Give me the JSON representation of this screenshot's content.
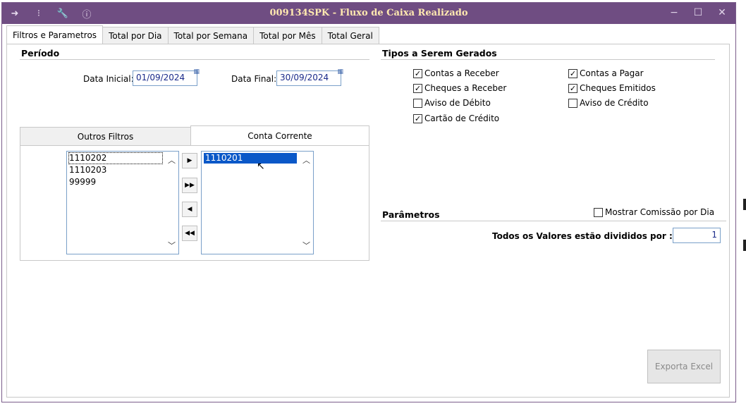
{
  "window": {
    "title": "009134SPK - Fluxo de Caixa Realizado",
    "toolbar_icons": [
      "menu-expand-icon",
      "tools-icon",
      "wrench-icon",
      "info-icon"
    ],
    "buttons": {
      "minimize": "−",
      "maximize": "☐",
      "close": "✕"
    }
  },
  "tabs": [
    {
      "label": "Filtros e Parametros",
      "active": true
    },
    {
      "label": "Total por Dia"
    },
    {
      "label": "Total por Semana"
    },
    {
      "label": "Total por Mês"
    },
    {
      "label": "Total Geral"
    }
  ],
  "periodo": {
    "title": "Período",
    "data_inicial_label": "Data Inicial:",
    "data_inicial": "01/09/2024",
    "data_final_label": "Data Final:",
    "data_final": "30/09/2024"
  },
  "subtabs": [
    {
      "label": "Outros Filtros"
    },
    {
      "label": "Conta Corrente",
      "active": true
    }
  ],
  "available_list": [
    "1110202",
    "1110203",
    "99999"
  ],
  "selected_list": [
    "1110201"
  ],
  "move_buttons": {
    "add_one": "▶",
    "add_all": "▶▶",
    "remove_one": "◀",
    "remove_all": "◀◀"
  },
  "tipos": {
    "title": "Tipos a Serem Gerados",
    "items": [
      {
        "label": "Contas a Receber",
        "checked": true
      },
      {
        "label": "Contas a Pagar",
        "checked": true
      },
      {
        "label": "Cheques a Receber",
        "checked": true
      },
      {
        "label": "Cheques Emitidos",
        "checked": true
      },
      {
        "label": "Aviso de Débito",
        "checked": false
      },
      {
        "label": "Aviso de Crédito",
        "checked": false
      },
      {
        "label": "Cartão de Crédito",
        "checked": true
      }
    ]
  },
  "parametros": {
    "title": "Parâmetros",
    "mostrar_comissao_label": "Mostrar Comissão por Dia",
    "mostrar_comissao_checked": false,
    "divisor_label": "Todos os Valores estão divididos por :",
    "divisor_value": "1"
  },
  "export_button": "Exporta Excel",
  "check_mark": "✓"
}
